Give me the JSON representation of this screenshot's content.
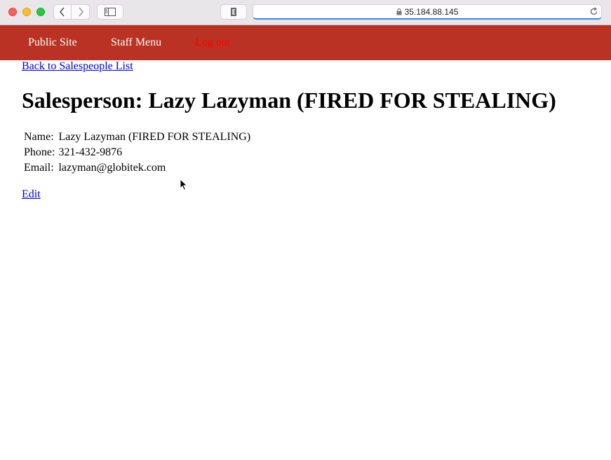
{
  "browser": {
    "address": "35.184.88.145",
    "icons": [
      "back-icon",
      "forward-icon",
      "sidebar-icon",
      "extension-icon",
      "lock-icon",
      "reload-icon"
    ]
  },
  "nav": {
    "public_site": "Public Site",
    "staff_menu": "Staff Menu",
    "log_out": "Log out"
  },
  "page": {
    "back_link": "Back to Salespeople List",
    "title": "Salesperson: Lazy Lazyman (FIRED FOR STEALING)",
    "details": [
      {
        "label": "Name:",
        "value": "Lazy Lazyman (FIRED FOR STEALING)"
      },
      {
        "label": "Phone:",
        "value": "321-432-9876"
      },
      {
        "label": "Email:",
        "value": "lazyman@globitek.com"
      }
    ],
    "edit_link": "Edit"
  },
  "colors": {
    "nav_background": "#b93223",
    "logout_text": "#ff0000",
    "link": "#0000ee"
  }
}
